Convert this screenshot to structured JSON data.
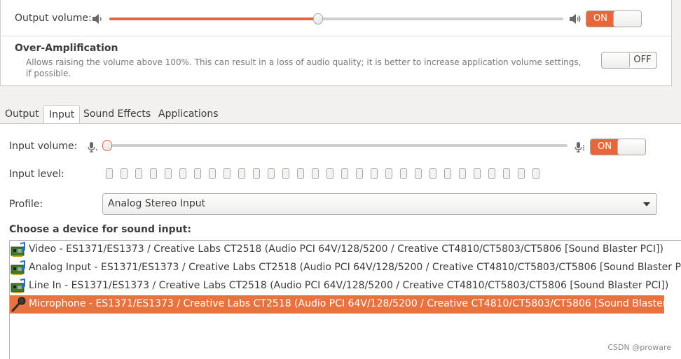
{
  "output": {
    "volume_label": "Output volume:",
    "volume_percent": 46,
    "toggle_label": "ON",
    "low_icon": "speaker-low-icon",
    "high_icon": "speaker-high-icon"
  },
  "amplification": {
    "title": "Over-Amplification",
    "description": "Allows raising the volume above 100%. This can result in a loss of audio quality; it is better to increase application volume settings, if possible.",
    "toggle_label": "OFF"
  },
  "tabs": [
    {
      "label": "Output",
      "active": false
    },
    {
      "label": "Input",
      "active": true
    },
    {
      "label": "Sound Effects",
      "active": false
    },
    {
      "label": "Applications",
      "active": false
    }
  ],
  "input": {
    "volume_label": "Input volume:",
    "volume_percent": 0,
    "toggle_label": "ON",
    "level_label": "Input level:",
    "level_cells": 30,
    "level_lit": 0,
    "profile_label": "Profile:",
    "profile_value": "Analog Stereo Input",
    "choose_label": "Choose a device for sound input:",
    "devices": [
      {
        "name": "Video - ES1371/ES1373 / Creative Labs CT2518 (Audio PCI 64V/128/5200 / Creative CT4810/CT5803/CT5806 [Sound Blaster PCI])",
        "icon": "sound-card-icon",
        "selected": false
      },
      {
        "name": "Analog Input - ES1371/ES1373 / Creative Labs CT2518 (Audio PCI 64V/128/5200 / Creative CT4810/CT5803/CT5806 [Sound Blaster PCI])",
        "icon": "sound-card-icon",
        "selected": false
      },
      {
        "name": "Line In - ES1371/ES1373 / Creative Labs CT2518 (Audio PCI 64V/128/5200 / Creative CT4810/CT5803/CT5806 [Sound Blaster PCI])",
        "icon": "sound-card-icon",
        "selected": false
      },
      {
        "name": "Microphone - ES1371/ES1373 / Creative Labs CT2518 (Audio PCI 64V/128/5200 / Creative CT4810/CT5803/CT5806 [Sound Blaster PCI])",
        "icon": "microphone-icon",
        "selected": true
      }
    ]
  },
  "watermark": "CSDN @proware",
  "colors": {
    "accent": "#e9663a",
    "selection": "#e9733f"
  }
}
